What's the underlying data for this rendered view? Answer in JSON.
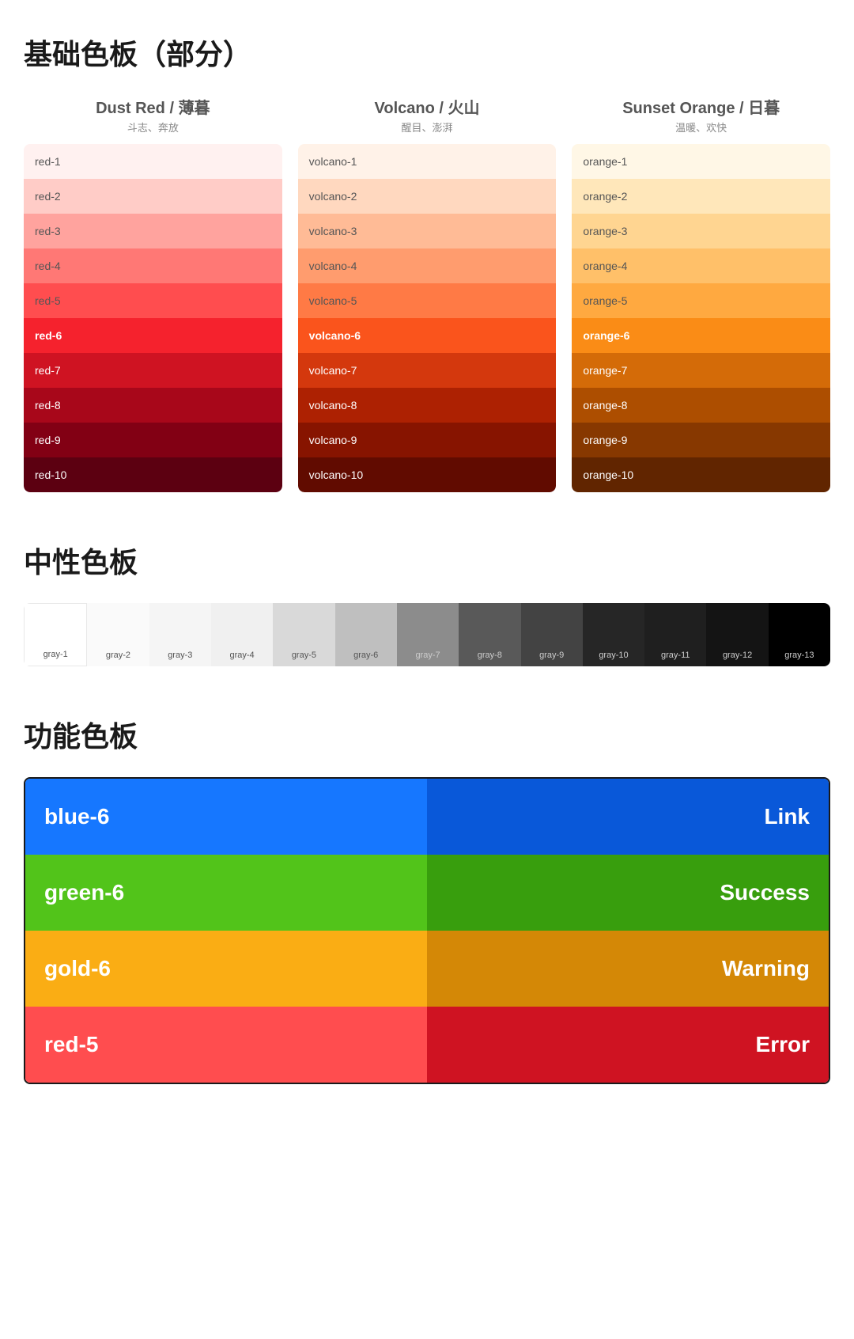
{
  "page": {
    "basic_palette_title": "基础色板（部分）",
    "neutral_palette_title": "中性色板",
    "functional_palette_title": "功能色板"
  },
  "basic_palette": {
    "columns": [
      {
        "id": "red",
        "title_en": "Dust Red / 薄暮",
        "title_zh": "斗志、奔放",
        "swatches": [
          {
            "label": "red-1",
            "color": "#fff1f0",
            "text_dark": true
          },
          {
            "label": "red-2",
            "color": "#ffccc7",
            "text_dark": true
          },
          {
            "label": "red-3",
            "color": "#ffa39e",
            "text_dark": true
          },
          {
            "label": "red-4",
            "color": "#ff7875",
            "text_dark": true
          },
          {
            "label": "red-5",
            "color": "#ff4d4f",
            "text_dark": true
          },
          {
            "label": "red-6",
            "color": "#f5222d",
            "text_dark": false,
            "bold": true
          },
          {
            "label": "red-7",
            "color": "#cf1322",
            "text_dark": false
          },
          {
            "label": "red-8",
            "color": "#a8071a",
            "text_dark": false
          },
          {
            "label": "red-9",
            "color": "#820014",
            "text_dark": false
          },
          {
            "label": "red-10",
            "color": "#5c0011",
            "text_dark": false
          }
        ]
      },
      {
        "id": "volcano",
        "title_en": "Volcano / 火山",
        "title_zh": "醒目、澎湃",
        "swatches": [
          {
            "label": "volcano-1",
            "color": "#fff2e8",
            "text_dark": true
          },
          {
            "label": "volcano-2",
            "color": "#ffd8bf",
            "text_dark": true
          },
          {
            "label": "volcano-3",
            "color": "#ffbb96",
            "text_dark": true
          },
          {
            "label": "volcano-4",
            "color": "#ff9c6e",
            "text_dark": true
          },
          {
            "label": "volcano-5",
            "color": "#ff7a45",
            "text_dark": true
          },
          {
            "label": "volcano-6",
            "color": "#fa541c",
            "text_dark": false,
            "bold": true
          },
          {
            "label": "volcano-7",
            "color": "#d4380d",
            "text_dark": false
          },
          {
            "label": "volcano-8",
            "color": "#ad2102",
            "text_dark": false
          },
          {
            "label": "volcano-9",
            "color": "#871400",
            "text_dark": false
          },
          {
            "label": "volcano-10",
            "color": "#610b00",
            "text_dark": false
          }
        ]
      },
      {
        "id": "orange",
        "title_en": "Sunset Orange / 日暮",
        "title_zh": "温暖、欢快",
        "swatches": [
          {
            "label": "orange-1",
            "color": "#fff7e6",
            "text_dark": true
          },
          {
            "label": "orange-2",
            "color": "#ffe7ba",
            "text_dark": true
          },
          {
            "label": "orange-3",
            "color": "#ffd591",
            "text_dark": true
          },
          {
            "label": "orange-4",
            "color": "#ffc069",
            "text_dark": true
          },
          {
            "label": "orange-5",
            "color": "#ffa940",
            "text_dark": true
          },
          {
            "label": "orange-6",
            "color": "#fa8c16",
            "text_dark": false,
            "bold": true
          },
          {
            "label": "orange-7",
            "color": "#d46b08",
            "text_dark": false
          },
          {
            "label": "orange-8",
            "color": "#ad4e00",
            "text_dark": false
          },
          {
            "label": "orange-9",
            "color": "#873800",
            "text_dark": false
          },
          {
            "label": "orange-10",
            "color": "#612500",
            "text_dark": false
          }
        ]
      }
    ]
  },
  "neutral_palette": {
    "swatches": [
      {
        "label": "gray-1",
        "color": "#ffffff",
        "text_dark": true
      },
      {
        "label": "gray-2",
        "color": "#fafafa",
        "text_dark": true
      },
      {
        "label": "gray-3",
        "color": "#f5f5f5",
        "text_dark": true
      },
      {
        "label": "gray-4",
        "color": "#f0f0f0",
        "text_dark": true
      },
      {
        "label": "gray-5",
        "color": "#d9d9d9",
        "text_dark": true
      },
      {
        "label": "gray-6",
        "color": "#bfbfbf",
        "text_dark": true
      },
      {
        "label": "gray-7",
        "color": "#8c8c8c",
        "text_dark": false
      },
      {
        "label": "gray-8",
        "color": "#595959",
        "text_dark": false
      },
      {
        "label": "gray-9",
        "color": "#434343",
        "text_dark": false
      },
      {
        "label": "gray-10",
        "color": "#262626",
        "text_dark": false
      },
      {
        "label": "gray-11",
        "color": "#1f1f1f",
        "text_dark": false
      },
      {
        "label": "gray-12",
        "color": "#141414",
        "text_dark": false
      },
      {
        "label": "gray-13",
        "color": "#000000",
        "text_dark": false
      }
    ]
  },
  "functional_palette": {
    "rows": [
      {
        "left_label": "blue-6",
        "right_label": "Link",
        "left_color": "#1677ff",
        "right_color": "#0958d9"
      },
      {
        "left_label": "green-6",
        "right_label": "Success",
        "left_color": "#52c41a",
        "right_color": "#389e0d"
      },
      {
        "left_label": "gold-6",
        "right_label": "Warning",
        "left_color": "#faad14",
        "right_color": "#d48806"
      },
      {
        "left_label": "red-5",
        "right_label": "Error",
        "left_color": "#ff4d4f",
        "right_color": "#cf1322"
      }
    ]
  }
}
